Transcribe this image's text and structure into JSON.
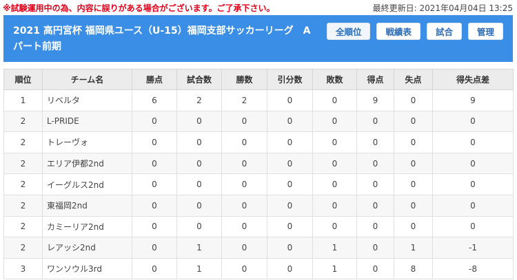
{
  "notice": "※試験運用中の為、内容に誤りがある場合がございます。ご了承下さい。",
  "last_updated": "最終更新日: 2021年04月04日 13:25",
  "header": {
    "title": "2021 高円宮杯 福岡県ユース（U-15）福岡支部サッカーリーグ　Aパート前期",
    "nav": [
      {
        "label": "全順位",
        "active": true
      },
      {
        "label": "戦績表",
        "active": false
      },
      {
        "label": "試合",
        "active": false
      },
      {
        "label": "管理",
        "active": false
      }
    ]
  },
  "table": {
    "columns": [
      "順位",
      "チーム名",
      "勝点",
      "試合数",
      "勝数",
      "引分数",
      "敗数",
      "得点",
      "失点",
      "得失点差"
    ],
    "rows": [
      [
        "1",
        "リベルタ",
        "6",
        "2",
        "2",
        "0",
        "0",
        "9",
        "0",
        "9"
      ],
      [
        "2",
        "L-PRIDE",
        "0",
        "0",
        "0",
        "0",
        "0",
        "0",
        "0",
        "0"
      ],
      [
        "2",
        "トレーヴォ",
        "0",
        "0",
        "0",
        "0",
        "0",
        "0",
        "0",
        "0"
      ],
      [
        "2",
        "エリア伊都2nd",
        "0",
        "0",
        "0",
        "0",
        "0",
        "0",
        "0",
        "0"
      ],
      [
        "2",
        "イーグルス2nd",
        "0",
        "0",
        "0",
        "0",
        "0",
        "0",
        "0",
        "0"
      ],
      [
        "2",
        "東福岡2nd",
        "0",
        "0",
        "0",
        "0",
        "0",
        "0",
        "0",
        "0"
      ],
      [
        "2",
        "カミーリア2nd",
        "0",
        "0",
        "0",
        "0",
        "0",
        "0",
        "0",
        "0"
      ],
      [
        "2",
        "レアッシ2nd",
        "0",
        "1",
        "0",
        "0",
        "1",
        "0",
        "1",
        "-1"
      ],
      [
        "3",
        "ワンソウル3rd",
        "0",
        "1",
        "0",
        "0",
        "1",
        "0",
        "8",
        "-8"
      ]
    ]
  }
}
